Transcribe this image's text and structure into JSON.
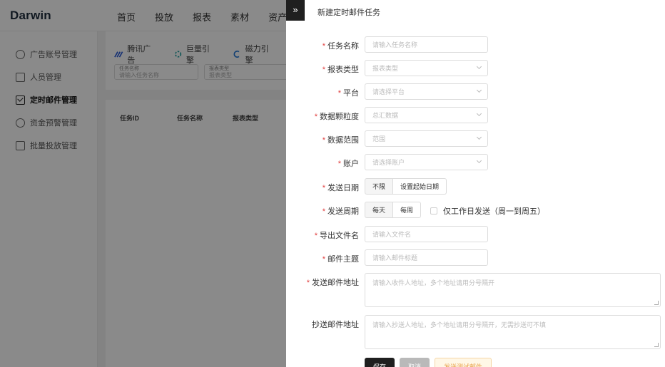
{
  "app": {
    "logo": "Darwin",
    "topnav": [
      "首页",
      "投放",
      "报表",
      "素材",
      "资产"
    ],
    "sidebar": [
      {
        "label": "广告账号管理",
        "icon": "smile-icon"
      },
      {
        "label": "人员管理",
        "icon": "person-card-icon"
      },
      {
        "label": "定时邮件管理",
        "icon": "mail-icon",
        "active": true
      },
      {
        "label": "资金预警管理",
        "icon": "alert-circle-icon"
      },
      {
        "label": "批量投放管理",
        "icon": "batch-icon"
      }
    ],
    "platforms": [
      "腾讯广告",
      "巨量引擎",
      "磁力引擎"
    ],
    "filters": [
      {
        "label": "任务名称",
        "placeholder": "请输入任务名称"
      },
      {
        "label": "报表类型",
        "placeholder": "报表类型"
      }
    ],
    "table_headers": [
      "任务ID",
      "任务名称",
      "报表类型"
    ]
  },
  "drawer": {
    "collapse_icon": "»",
    "title": "新建定时邮件任务",
    "fields": {
      "task_name": {
        "label": "任务名称",
        "required": true,
        "placeholder": "请输入任务名称"
      },
      "report_type": {
        "label": "报表类型",
        "required": true,
        "placeholder": "报表类型"
      },
      "platform": {
        "label": "平台",
        "required": true,
        "placeholder": "请选择平台"
      },
      "granularity": {
        "label": "数据颗粒度",
        "required": true,
        "placeholder": "总汇数据"
      },
      "range": {
        "label": "数据范围",
        "required": true,
        "placeholder": "范围"
      },
      "account": {
        "label": "账户",
        "required": true,
        "placeholder": "请选择账户"
      },
      "send_date": {
        "label": "发送日期",
        "required": true,
        "options": [
          "不限",
          "设置起始日期"
        ]
      },
      "send_cycle": {
        "label": "发送周期",
        "required": true,
        "options": [
          "每天",
          "每周"
        ],
        "checkbox_label": "仅工作日发送（周一到周五）"
      },
      "file_name": {
        "label": "导出文件名",
        "required": true,
        "placeholder": "请输入文件名"
      },
      "subject": {
        "label": "邮件主题",
        "required": true,
        "placeholder": "请输入邮件标题"
      },
      "to": {
        "label": "发送邮件地址",
        "required": true,
        "placeholder": "请输入收件人地址，多个地址请用分号隔开"
      },
      "cc": {
        "label": "抄送邮件地址",
        "required": false,
        "placeholder": "请输入抄送人地址，多个地址请用分号隔开，无需抄送可不填"
      }
    },
    "actions": {
      "save": "保存",
      "cancel": "取消",
      "test": "发送测试邮件"
    },
    "required_mark": "*"
  }
}
